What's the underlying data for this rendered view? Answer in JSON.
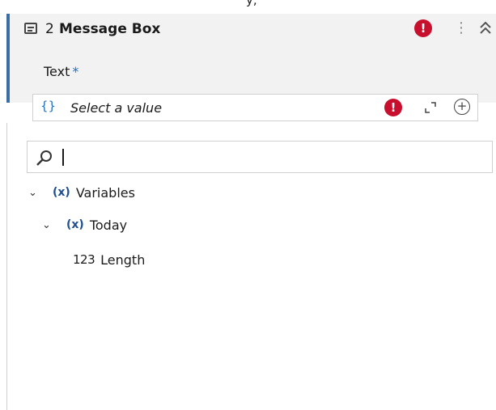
{
  "top_fragment": "y,",
  "activity": {
    "number": "2",
    "title": "Message Box",
    "error_glyph": "!",
    "more_glyph": "⋮",
    "icons": [
      "message-box-icon",
      "error-icon",
      "more-icon",
      "collapse-icon"
    ],
    "accent_color": "#3b6fa3"
  },
  "field": {
    "label": "Text",
    "required_mark": "*",
    "placeholder": "Select a value",
    "brace_glyph": "{}",
    "error_glyph": "!",
    "plus_glyph": "+",
    "icons": [
      "braces-icon",
      "error-icon",
      "expand-icon",
      "add-icon"
    ]
  },
  "dropdown": {
    "search_value": "",
    "tree": [
      {
        "label": "Variables",
        "icon": "(x)",
        "expanded": true,
        "level": 0
      },
      {
        "label": "Today",
        "icon": "(x)",
        "expanded": true,
        "level": 1
      },
      {
        "label": "Length",
        "icon": "123",
        "level": 2
      }
    ]
  },
  "colors": {
    "error": "#c8102e",
    "required": "#1f6fbf",
    "variable_icon": "#1f4f8f"
  }
}
